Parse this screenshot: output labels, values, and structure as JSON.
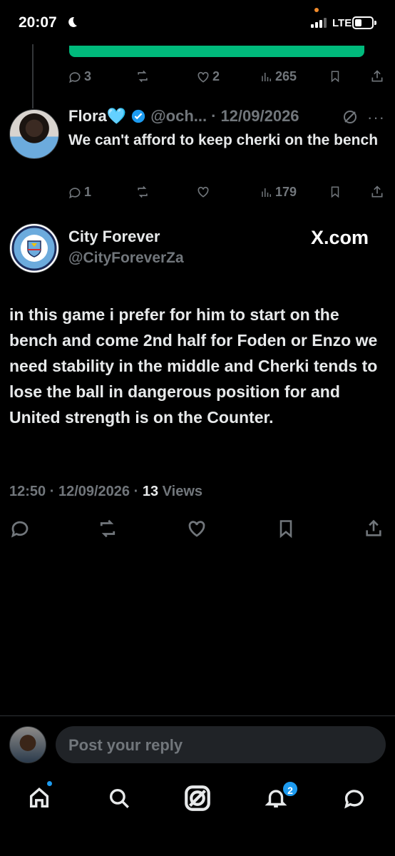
{
  "status_bar": {
    "time": "20:07",
    "network": "LTE"
  },
  "previous_tweet": {
    "actions": {
      "replies": "3",
      "likes": "2",
      "views": "265"
    }
  },
  "flora_tweet": {
    "name": "Flora",
    "name_emoji": "🩵",
    "handle": "@och...",
    "separator": "·",
    "date": "12/09/2026",
    "text": "We can't afford to keep cherki on the bench",
    "actions": {
      "replies": "1",
      "views": "179"
    }
  },
  "main_tweet": {
    "name": "City Forever",
    "handle": "@CityForeverZa",
    "watermark": "X.com",
    "text": "in this game i prefer for him to start on the bench and come 2nd half for Foden or Enzo we need stability in the middle and Cherki tends to lose the ball in dangerous position for and United strength is on the Counter.",
    "time": "12:50",
    "separator": "·",
    "date": "12/09/2026",
    "views_count": "13",
    "views_label": "Views"
  },
  "reply_bar": {
    "placeholder": "Post your reply"
  },
  "tabbar": {
    "notifications_badge": "2"
  },
  "colors": {
    "accent": "#1d9bf0",
    "verified": "#1d9bf0",
    "muted": "#71767b",
    "progress": "#00ba7c"
  }
}
